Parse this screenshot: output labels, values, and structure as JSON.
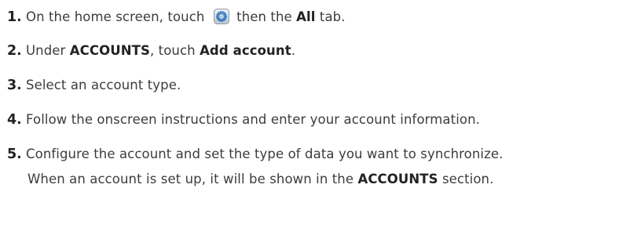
{
  "steps": [
    {
      "number": "1",
      "dot": ".",
      "text_a": " On the home screen, touch ",
      "icon": "settings-icon",
      "text_b": " then the ",
      "bold_a": "All",
      "text_c": " tab."
    },
    {
      "number": "2",
      "dot": ".",
      "text_a": " Under ",
      "bold_a": "ACCOUNTS",
      "text_b": ", touch ",
      "bold_b": "Add account",
      "text_c": "."
    },
    {
      "number": "3",
      "dot": ".",
      "text_a": " Select an account type."
    },
    {
      "number": "4",
      "dot": ".",
      "text_a": " Follow the onscreen instructions and enter your account information."
    },
    {
      "number": "5",
      "dot": ".",
      "text_a": " Configure the account and set the type of data you want to synchronize.",
      "cont_text_a": "When an account is set up, it will be shown in the ",
      "cont_bold_a": "ACCOUNTS",
      "cont_text_b": " section."
    }
  ],
  "colors": {
    "text": "#3c3c3c",
    "bold": "#222222",
    "icon_blue": "#2a7fc4"
  }
}
